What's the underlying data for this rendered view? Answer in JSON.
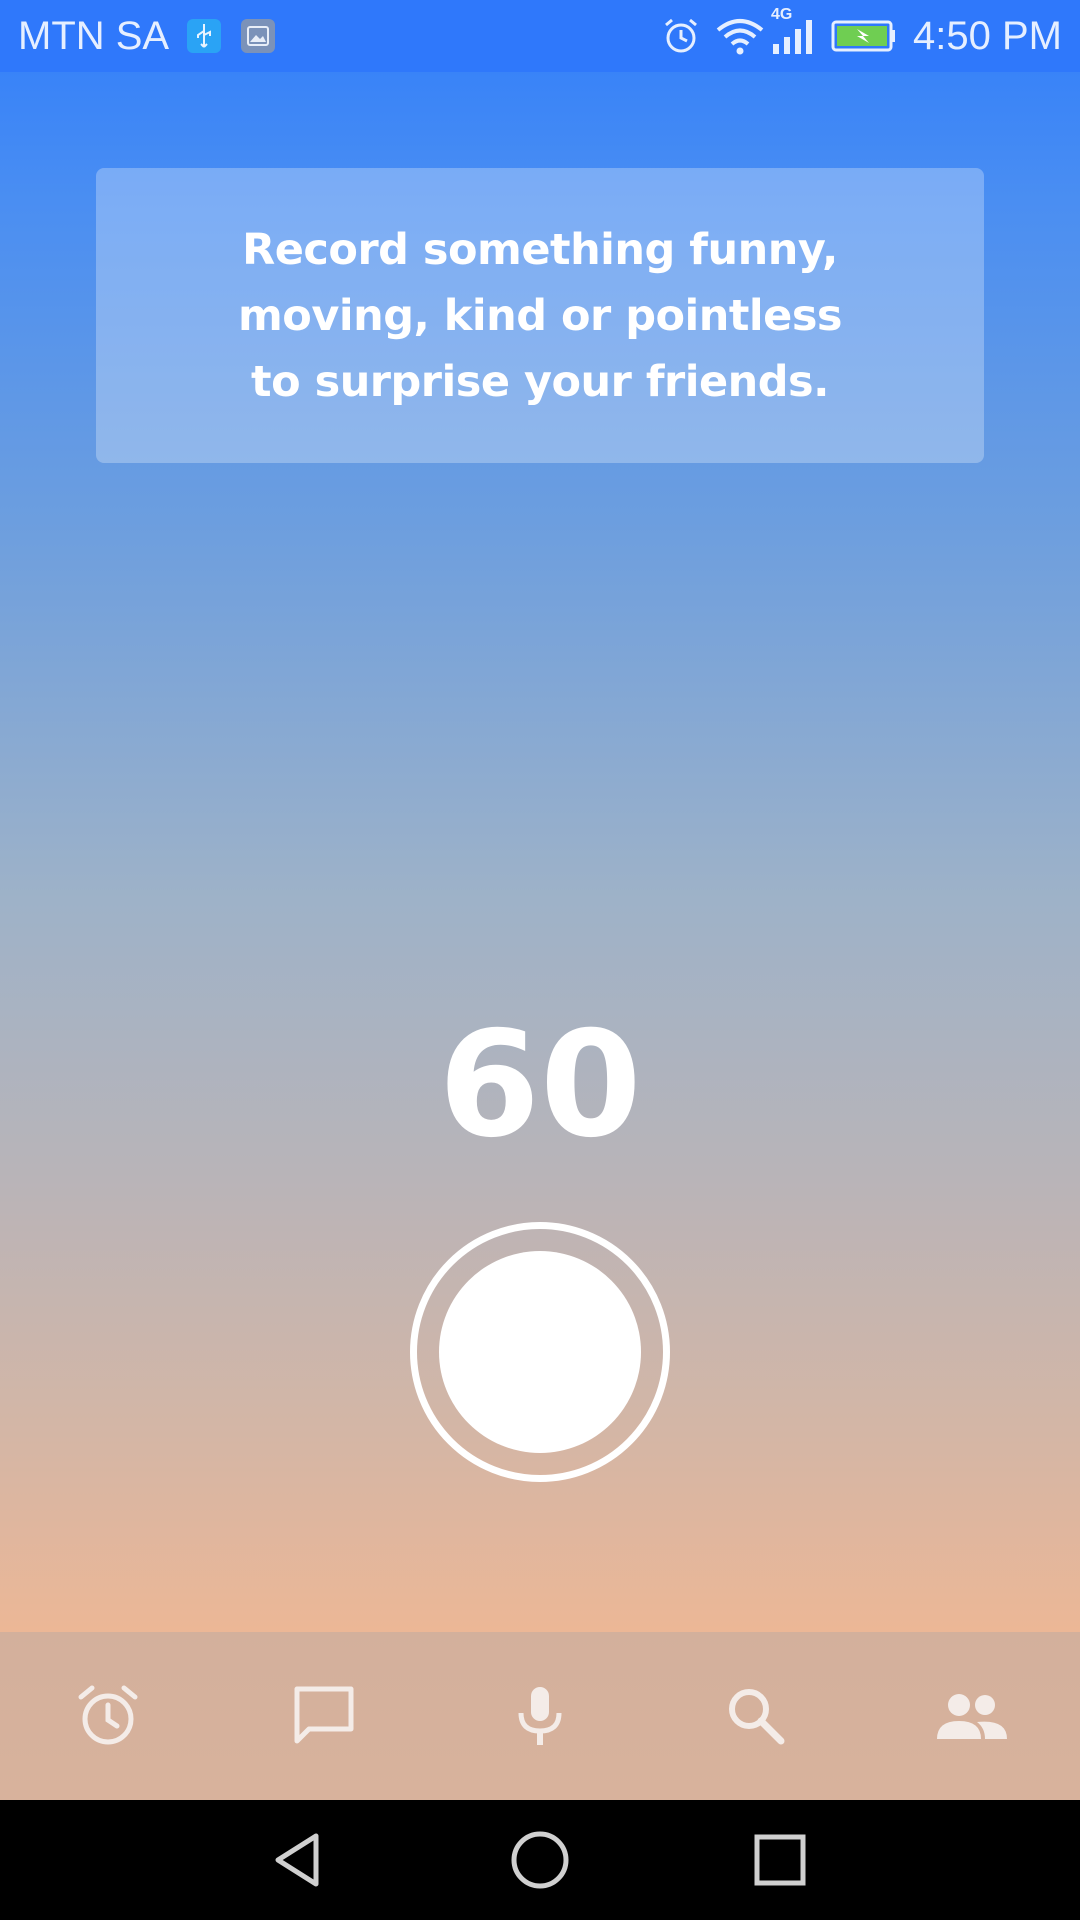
{
  "status_bar": {
    "carrier": "MTN SA",
    "network_type": "4G",
    "time": "4:50 PM",
    "icons": [
      "usb-icon",
      "image-icon",
      "alarm-icon",
      "wifi-icon",
      "signal-icon",
      "battery-charging-icon"
    ]
  },
  "prompt": {
    "text": "Record something funny,\nmoving, kind or pointless\nto surprise your friends."
  },
  "counter": {
    "value": "60"
  },
  "record_button": {
    "icon": "record-icon"
  },
  "bottom_nav": {
    "items": [
      {
        "icon": "alarm-clock-icon"
      },
      {
        "icon": "chat-bubble-icon"
      },
      {
        "icon": "microphone-icon"
      },
      {
        "icon": "search-icon"
      },
      {
        "icon": "people-icon"
      }
    ],
    "icon_color": "#f4ece8"
  },
  "system_nav": {
    "buttons": [
      "back-icon",
      "home-icon",
      "recents-icon"
    ]
  },
  "colors": {
    "status_bar": "#2f78fb",
    "gradient_top": "#2f7dfb",
    "gradient_bottom": "#ecb796",
    "nav_background": "#d5b19c"
  }
}
